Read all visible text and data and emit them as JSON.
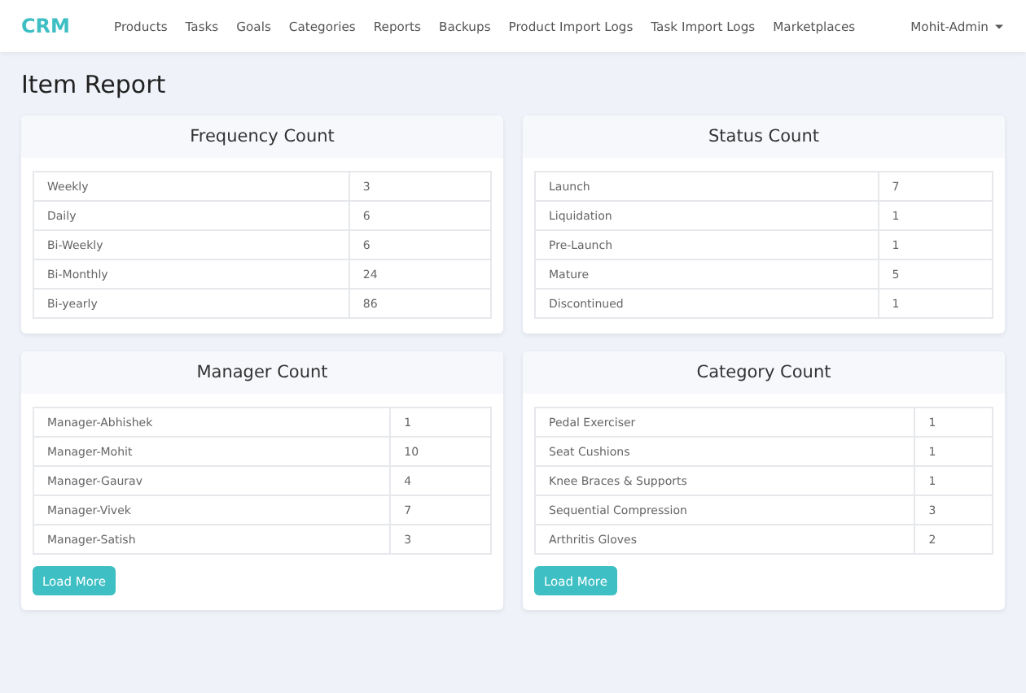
{
  "navbar": {
    "brand": "CRM",
    "links": [
      "Products",
      "Tasks",
      "Goals",
      "Categories",
      "Reports",
      "Backups",
      "Product Import Logs",
      "Task Import Logs",
      "Marketplaces"
    ],
    "user": "Mohit-Admin"
  },
  "page_title": "Item Report",
  "cards": [
    {
      "title": "Frequency Count",
      "rows": [
        [
          "Weekly",
          "3"
        ],
        [
          "Daily",
          "6"
        ],
        [
          "Bi-Weekly",
          "6"
        ],
        [
          "Bi-Monthly",
          "24"
        ],
        [
          "Bi-yearly",
          "86"
        ]
      ]
    },
    {
      "title": "Status Count",
      "rows": [
        [
          "Launch",
          "7"
        ],
        [
          "Liquidation",
          "1"
        ],
        [
          "Pre-Launch",
          "1"
        ],
        [
          "Mature",
          "5"
        ],
        [
          "Discontinued",
          "1"
        ]
      ]
    },
    {
      "title": "Manager Count",
      "rows": [
        [
          "Manager-Abhishek",
          "1"
        ],
        [
          "Manager-Mohit",
          "10"
        ],
        [
          "Manager-Gaurav",
          "4"
        ],
        [
          "Manager-Vivek",
          "7"
        ],
        [
          "Manager-Satish",
          "3"
        ]
      ],
      "button": "Load More"
    },
    {
      "title": "Category Count",
      "rows": [
        [
          "Pedal Exerciser",
          "1"
        ],
        [
          "Seat Cushions",
          "1"
        ],
        [
          "Knee Braces & Supports",
          "1"
        ],
        [
          "Sequential Compression",
          "3"
        ],
        [
          "Arthritis Gloves",
          "2"
        ]
      ],
      "button": "Load More"
    }
  ]
}
